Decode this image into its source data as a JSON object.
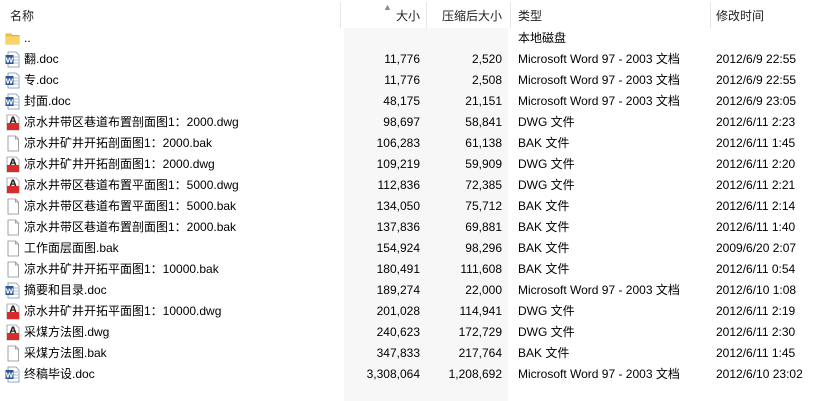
{
  "columns": {
    "name": "名称",
    "size": "大小",
    "compressed": "压缩后大小",
    "type": "类型",
    "modified": "修改时间"
  },
  "files": [
    {
      "name": "..",
      "size": "",
      "compressed": "",
      "type": "本地磁盘",
      "modified": "",
      "icon": "folder-icon"
    },
    {
      "name": "翻.doc",
      "size": "11,776",
      "compressed": "2,520",
      "type": "Microsoft Word 97 - 2003 文档",
      "modified": "2012/6/9 22:55",
      "icon": "word-doc-icon"
    },
    {
      "name": "专.doc",
      "size": "11,776",
      "compressed": "2,508",
      "type": "Microsoft Word 97 - 2003 文档",
      "modified": "2012/6/9 22:55",
      "icon": "word-doc-icon"
    },
    {
      "name": "封面.doc",
      "size": "48,175",
      "compressed": "21,151",
      "type": "Microsoft Word 97 - 2003 文档",
      "modified": "2012/6/9 23:05",
      "icon": "word-doc-icon"
    },
    {
      "name": "凉水井带区巷道布置剖面图1：2000.dwg",
      "size": "98,697",
      "compressed": "58,841",
      "type": "DWG 文件",
      "modified": "2012/6/11 2:23",
      "icon": "dwg-file-icon"
    },
    {
      "name": "凉水井矿井开拓剖面图1：2000.bak",
      "size": "106,283",
      "compressed": "61,138",
      "type": "BAK 文件",
      "modified": "2012/6/11 1:45",
      "icon": "blank-file-icon"
    },
    {
      "name": "凉水井矿井开拓剖面图1：2000.dwg",
      "size": "109,219",
      "compressed": "59,909",
      "type": "DWG 文件",
      "modified": "2012/6/11 2:20",
      "icon": "dwg-file-icon"
    },
    {
      "name": "凉水井带区巷道布置平面图1：5000.dwg",
      "size": "112,836",
      "compressed": "72,385",
      "type": "DWG 文件",
      "modified": "2012/6/11 2:21",
      "icon": "dwg-file-icon"
    },
    {
      "name": "凉水井带区巷道布置平面图1：5000.bak",
      "size": "134,050",
      "compressed": "75,712",
      "type": "BAK 文件",
      "modified": "2012/6/11 2:14",
      "icon": "blank-file-icon"
    },
    {
      "name": "凉水井带区巷道布置剖面图1：2000.bak",
      "size": "137,836",
      "compressed": "69,881",
      "type": "BAK 文件",
      "modified": "2012/6/11 1:40",
      "icon": "blank-file-icon"
    },
    {
      "name": "工作面层面图.bak",
      "size": "154,924",
      "compressed": "98,296",
      "type": "BAK 文件",
      "modified": "2009/6/20 2:07",
      "icon": "blank-file-icon"
    },
    {
      "name": "凉水井矿井开拓平面图1：10000.bak",
      "size": "180,491",
      "compressed": "111,608",
      "type": "BAK 文件",
      "modified": "2012/6/11 0:54",
      "icon": "blank-file-icon"
    },
    {
      "name": "摘要和目录.doc",
      "size": "189,274",
      "compressed": "22,000",
      "type": "Microsoft Word 97 - 2003 文档",
      "modified": "2012/6/10 1:08",
      "icon": "word-doc-icon"
    },
    {
      "name": "凉水井矿井开拓平面图1：10000.dwg",
      "size": "201,028",
      "compressed": "114,941",
      "type": "DWG 文件",
      "modified": "2012/6/11 2:19",
      "icon": "dwg-file-icon"
    },
    {
      "name": "采煤方法图.dwg",
      "size": "240,623",
      "compressed": "172,729",
      "type": "DWG 文件",
      "modified": "2012/6/11 2:30",
      "icon": "dwg-file-icon"
    },
    {
      "name": "采煤方法图.bak",
      "size": "347,833",
      "compressed": "217,764",
      "type": "BAK 文件",
      "modified": "2012/6/11 1:45",
      "icon": "blank-file-icon"
    },
    {
      "name": "终稿毕设.doc",
      "size": "3,308,064",
      "compressed": "1,208,692",
      "type": "Microsoft Word 97 - 2003 文档",
      "modified": "2012/6/10 23:02",
      "icon": "word-doc-icon"
    }
  ],
  "colors": {
    "sorted_column_bg": "#f7f7f7",
    "word_blue": "#2b579a",
    "dwg_red": "#d92b2b",
    "folder_yellow": "#f5c542"
  }
}
